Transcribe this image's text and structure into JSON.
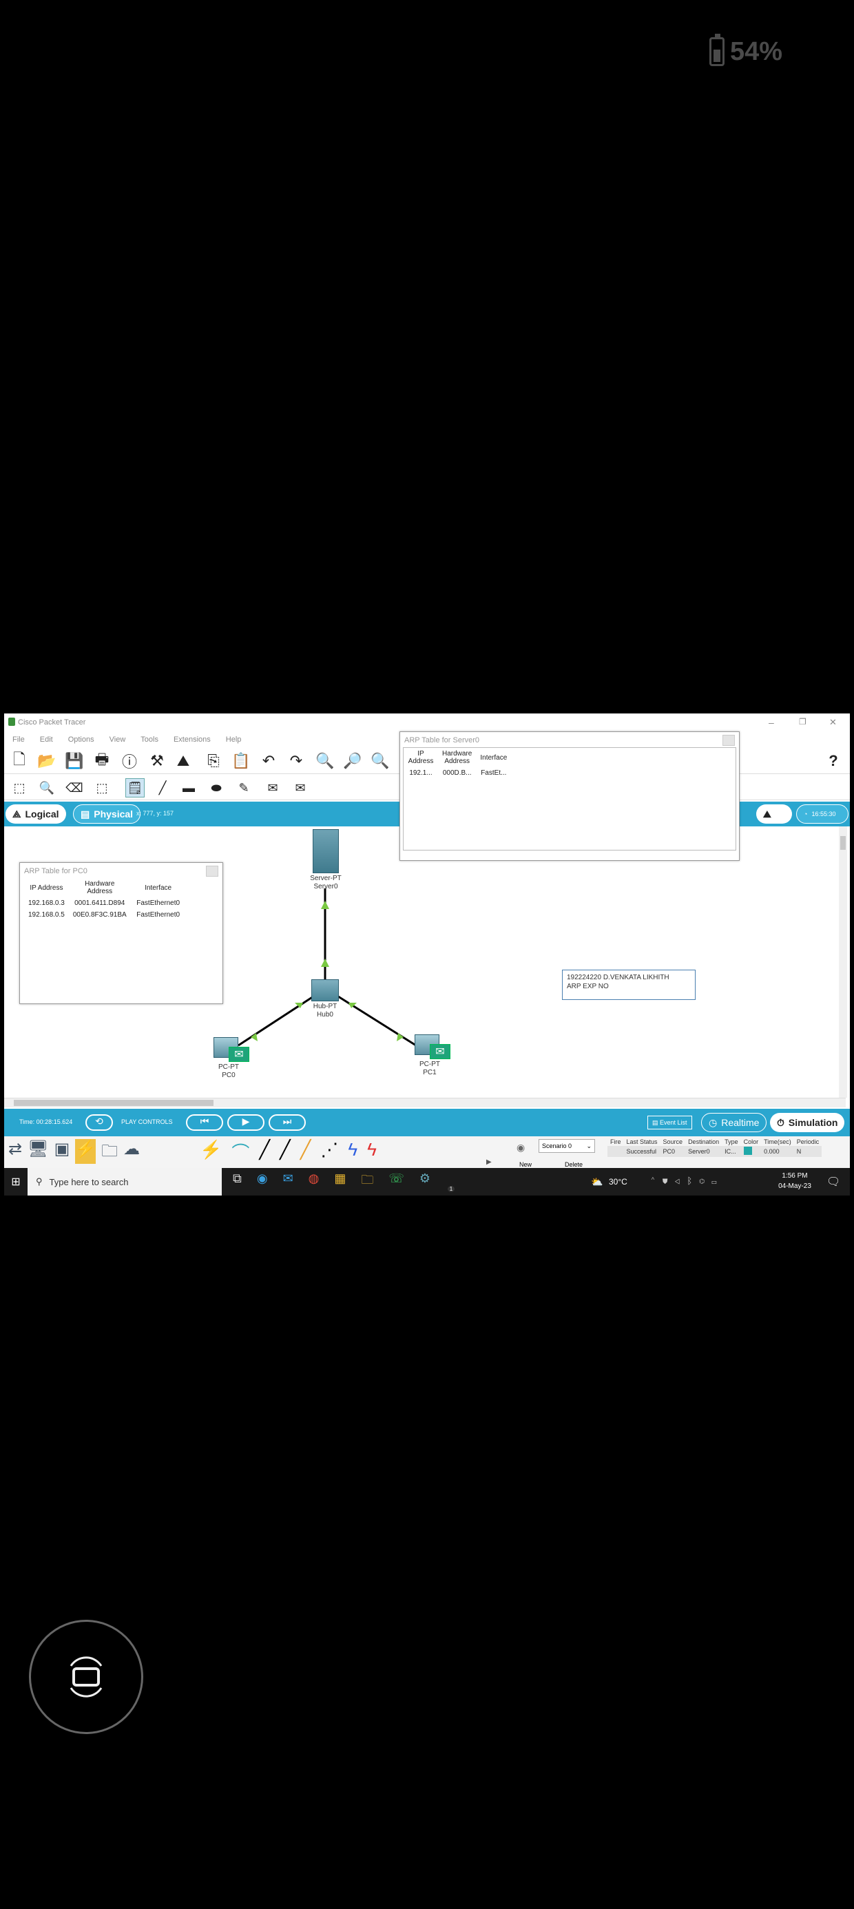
{
  "status": {
    "battery_percent": "54%"
  },
  "window": {
    "title": "Cisco Packet Tracer",
    "controls": [
      "–",
      "❐",
      "✕"
    ]
  },
  "menu": [
    "File",
    "Edit",
    "Options",
    "View",
    "Tools",
    "Extensions",
    "Help"
  ],
  "modes": {
    "logical": "Logical",
    "physical": "Physical",
    "coords": "x: 777, y: 157",
    "clock": "16:55:30"
  },
  "arp_pc0": {
    "title": "ARP Table for PC0",
    "headers": [
      "IP Address",
      "Hardware Address",
      "Interface"
    ],
    "rows": [
      [
        "192.168.0.3",
        "0001.6411.D894",
        "FastEthernet0"
      ],
      [
        "192.168.0.5",
        "00E0.8F3C.91BA",
        "FastEthernet0"
      ]
    ]
  },
  "arp_server0": {
    "title": "ARP Table for Server0",
    "headers": [
      "IP Address",
      "Hardware Address",
      "Interface"
    ],
    "rows": [
      [
        "192.1...",
        "000D.B...",
        "FastEt..."
      ]
    ]
  },
  "topology": {
    "server": {
      "type": "Server-PT",
      "name": "Server0"
    },
    "hub": {
      "type": "Hub-PT",
      "name": "Hub0"
    },
    "pc0": {
      "type": "PC-PT",
      "name": "PC0"
    },
    "pc1": {
      "type": "PC-PT",
      "name": "PC1"
    },
    "note": [
      "192224220 D.VENKATA LIKHITH",
      "ARP EXP NO"
    ]
  },
  "sim": {
    "time": "Time: 00:28:15.624",
    "play_controls": "PLAY CONTROLS",
    "event_list": "Event List",
    "realtime": "Realtime",
    "simulation": "Simulation"
  },
  "scenario": {
    "selected": "Scenario 0",
    "new": "New",
    "delete": "Delete"
  },
  "pdu_table": {
    "headers": [
      "Fire",
      "Last Status",
      "Source",
      "Destination",
      "Type",
      "Color",
      "Time(sec)",
      "Periodic"
    ],
    "rows": [
      [
        "",
        "Successful",
        "PC0",
        "Server0",
        "IC...",
        "",
        "0.000",
        "N"
      ]
    ]
  },
  "taskbar": {
    "search_placeholder": "Type here to search",
    "weather": "30°C",
    "time": "1:56 PM",
    "date": "04-May-23",
    "whatsapp_badge": "1"
  },
  "colors": {
    "accent": "#2aa6cf",
    "link": "#000000",
    "arrow": "#7ac943",
    "taskbar": "#1b1b1b"
  }
}
